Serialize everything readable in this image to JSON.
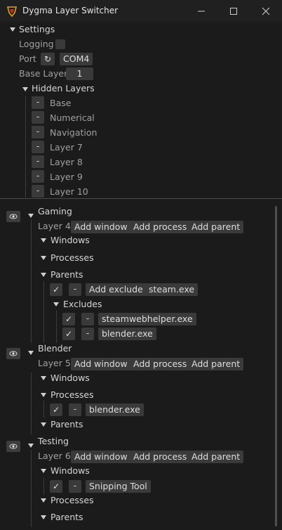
{
  "window": {
    "title": "Dygma Layer Switcher"
  },
  "settings": {
    "header": "Settings",
    "logging_label": "Logging",
    "port_label": "Port",
    "port_value": "COM4",
    "base_layer_label": "Base Layer",
    "base_layer_value": "1",
    "hidden_header": "Hidden Layers",
    "hidden_layers": [
      "Base",
      "Numerical",
      "Navigation",
      "Layer 7",
      "Layer 8",
      "Layer 9",
      "Layer 10"
    ]
  },
  "buttons": {
    "add_window": "Add window",
    "add_process": "Add process",
    "add_parent": "Add parent",
    "add_exclude": "Add exclude",
    "remove": "-"
  },
  "groups": {
    "windows": "Windows",
    "processes": "Processes",
    "parents": "Parents",
    "excludes": "Excludes"
  },
  "layers": [
    {
      "name": "Gaming",
      "layer": "Layer 4",
      "parents": [
        "steam.exe"
      ],
      "excludes": [
        "steamwebhelper.exe",
        "blender.exe"
      ]
    },
    {
      "name": "Blender",
      "layer": "Layer 5",
      "processes": [
        "blender.exe"
      ]
    },
    {
      "name": "Testing",
      "layer": "Layer 6",
      "windows": [
        "Snipping Tool"
      ]
    }
  ],
  "icons": {
    "check": "✓",
    "refresh": "↻"
  }
}
